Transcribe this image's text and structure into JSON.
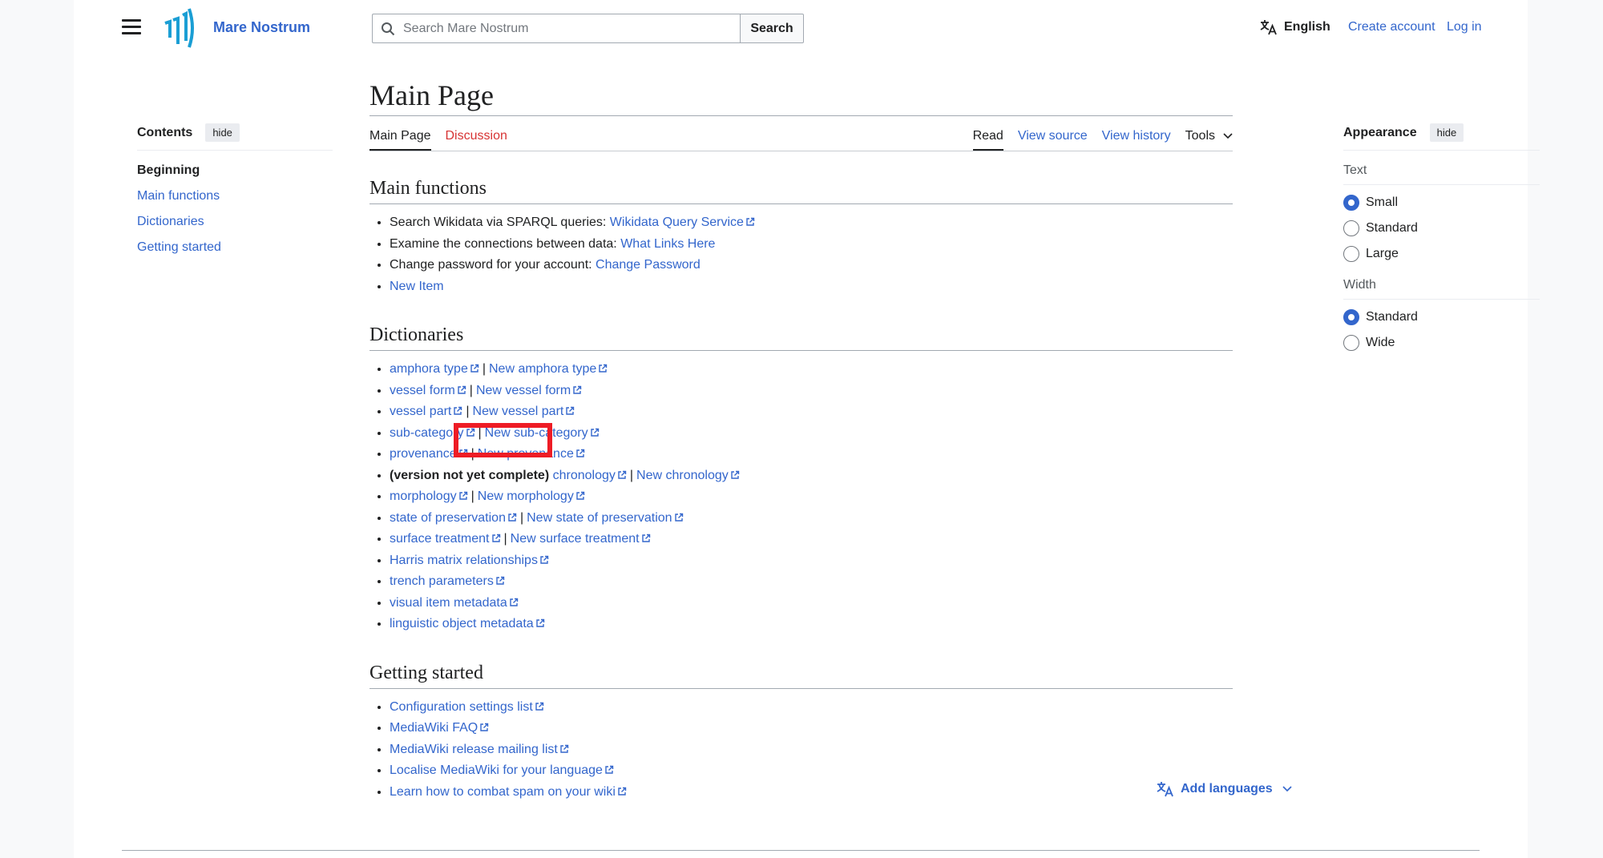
{
  "header": {
    "site_name": "Mare Nostrum",
    "search_placeholder": "Search Mare Nostrum",
    "search_button": "Search",
    "language": "English",
    "create_account": "Create account",
    "login": "Log in"
  },
  "toc": {
    "title": "Contents",
    "hide": "hide",
    "items": [
      "Beginning",
      "Main functions",
      "Dictionaries",
      "Getting started"
    ]
  },
  "page": {
    "title": "Main Page",
    "tabs_left": [
      "Main Page",
      "Discussion"
    ],
    "tabs_right": [
      "Read",
      "View source",
      "View history",
      "Tools"
    ]
  },
  "sections": {
    "main_functions": {
      "heading": "Main functions",
      "items": [
        {
          "text": "Search Wikidata via SPARQL queries: ",
          "link": "Wikidata Query Service"
        },
        {
          "text": "Examine the connections between data: ",
          "link": "What Links Here"
        },
        {
          "text": "Change password for your account: ",
          "link": "Change Password"
        },
        {
          "text": "",
          "link": "New Item"
        }
      ]
    },
    "dictionaries": {
      "heading": "Dictionaries",
      "items": [
        {
          "a": "amphora type",
          "b": "New amphora type"
        },
        {
          "a": "vessel form",
          "b": "New vessel form"
        },
        {
          "a": "vessel part",
          "b": "New vessel part"
        },
        {
          "a": "sub-category",
          "b": "New sub-category"
        },
        {
          "a": "provenance",
          "b": "New provenance"
        },
        {
          "prefix": "(version not yet complete)",
          "a": "chronology",
          "b": "New chronology"
        },
        {
          "a": "morphology",
          "b": "New morphology"
        },
        {
          "a": "state of preservation",
          "b": "New state of preservation"
        },
        {
          "a": "surface treatment",
          "b": "New surface treatment"
        },
        {
          "a": "Harris matrix relationships"
        },
        {
          "a": "trench parameters"
        },
        {
          "a": "visual item metadata"
        },
        {
          "a": "linguistic object metadata"
        }
      ]
    },
    "getting_started": {
      "heading": "Getting started",
      "items": [
        "Configuration settings list",
        "MediaWiki FAQ",
        "MediaWiki release mailing list",
        "Localise MediaWiki for your language",
        "Learn how to combat spam on your wiki"
      ]
    }
  },
  "add_languages": "Add languages",
  "appearance": {
    "title": "Appearance",
    "hide": "hide",
    "text_label": "Text",
    "text_options": [
      "Small",
      "Standard",
      "Large"
    ],
    "text_selected": "Small",
    "width_label": "Width",
    "width_options": [
      "Standard",
      "Wide"
    ],
    "width_selected": "Standard"
  },
  "colors": {
    "link": "#3366cc",
    "highlight": "#ee1c25",
    "new_link": "#d73333"
  }
}
